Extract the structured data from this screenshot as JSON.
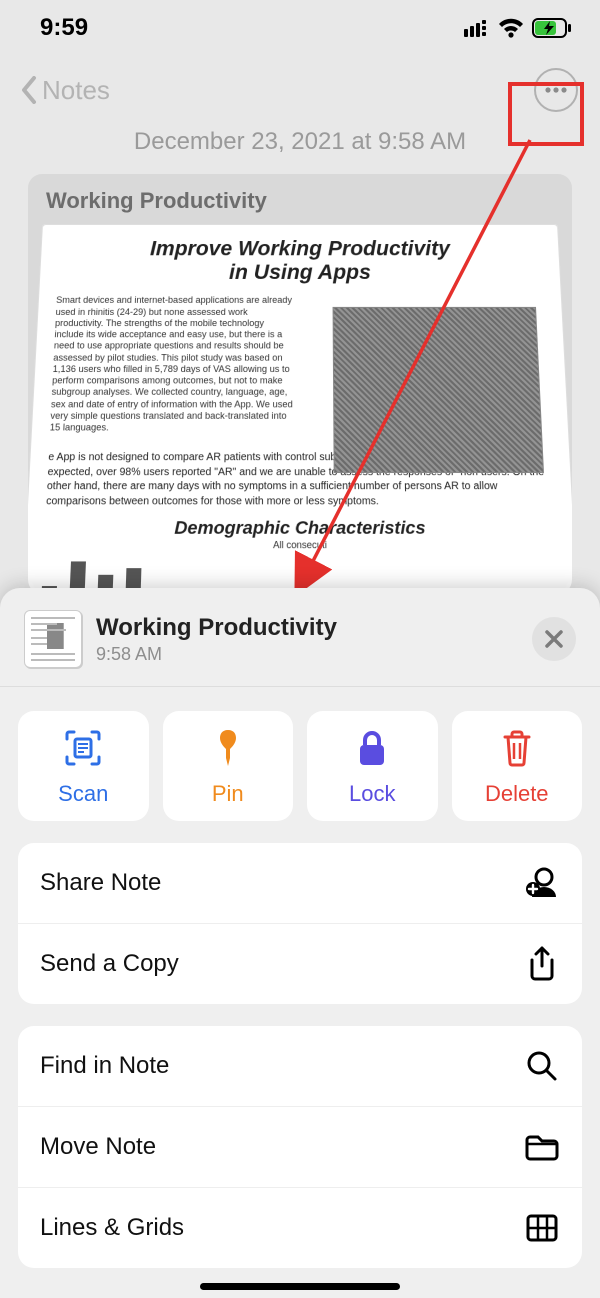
{
  "statusbar": {
    "time": "9:59"
  },
  "nav": {
    "back_label": "Notes"
  },
  "note": {
    "date_line": "December 23, 2021 at 9:58 AM",
    "title_bg": "Working Productivity",
    "doc_heading_line1": "Improve Working Productivity",
    "doc_heading_line2": "in Using Apps",
    "doc_para1": "Smart devices and internet-based applications are already used in rhinitis (24-29) but none assessed work productivity. The strengths of the mobile technology include its wide acceptance and easy use, but there is a need to use appropriate questions and results should be assessed by pilot studies. This pilot study was based on 1,136 users who filled in 5,789 days of VAS allowing us to perform comparisons among outcomes, but not to make subgroup analyses. We collected country, language, age, sex and date of entry of information with the App. We used very simple questions translated and back-translated into 15 languages.",
    "doc_para2": "e App is not designed to compare AR patients with control subjects and this was not a clinical trial. s, as expected, over 98% users reported \"AR\" and we are unable to assess the responses of \"non users. On the other hand, there are many days with no symptoms in a sufficient number of persons AR to allow comparisons between outcomes for those with more or less symptoms.",
    "doc_subheading": "Demographic Characteristics",
    "doc_sub_text": "All consecuti"
  },
  "sheet": {
    "title": "Working Productivity",
    "subtitle": "9:58 AM",
    "actions": {
      "scan": "Scan",
      "pin": "Pin",
      "lock": "Lock",
      "delete": "Delete"
    },
    "group1": {
      "share_note": "Share Note",
      "send_copy": "Send a Copy"
    },
    "group2": {
      "find": "Find in Note",
      "move": "Move Note",
      "lines": "Lines & Grids"
    }
  }
}
